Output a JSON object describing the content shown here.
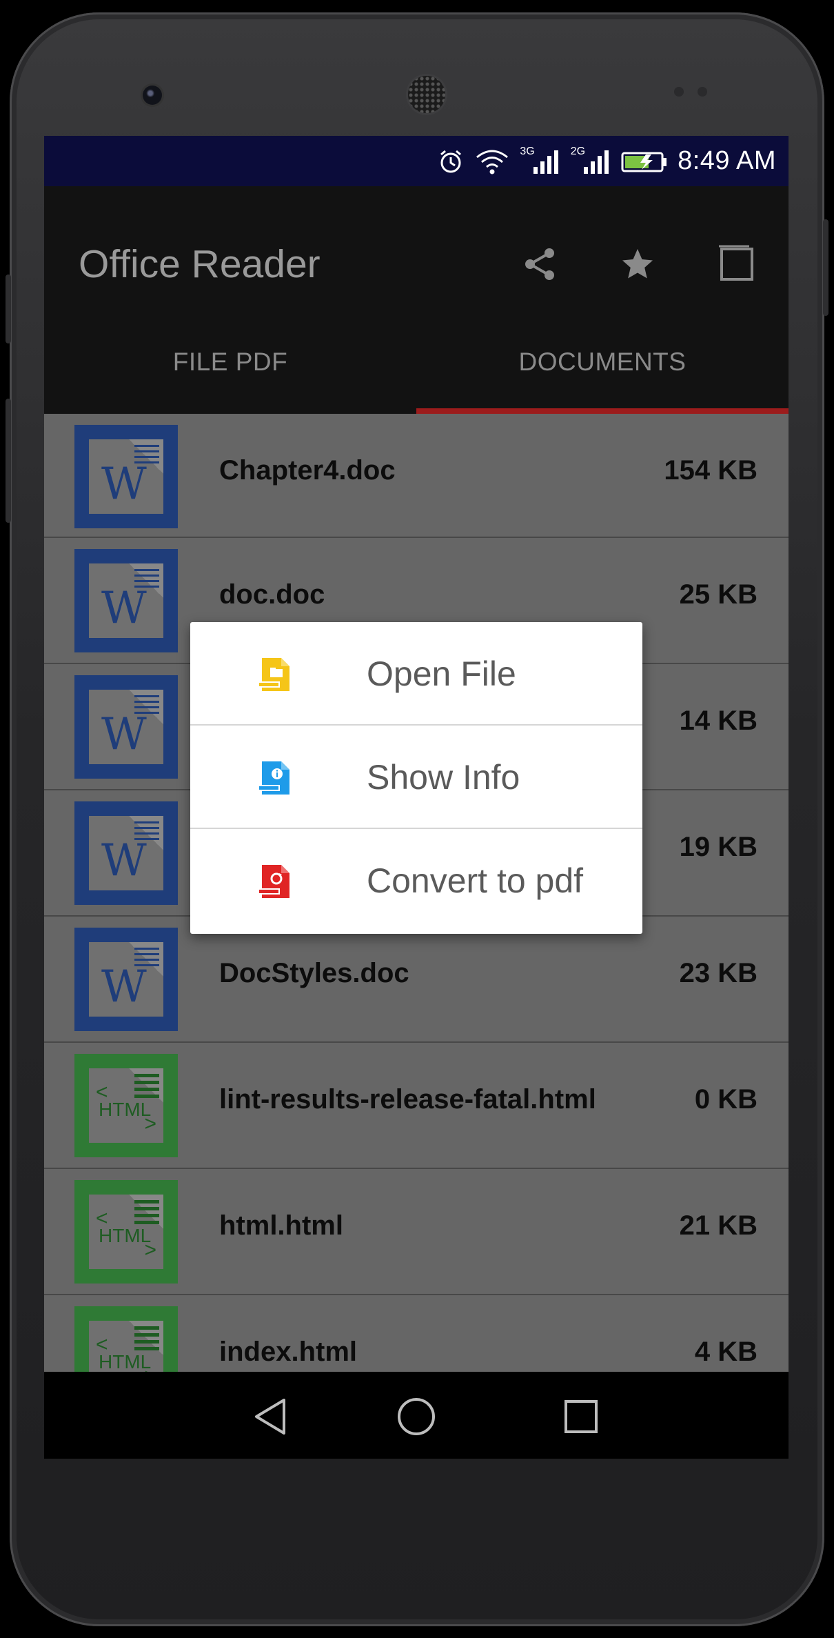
{
  "status_bar": {
    "time": "8:49 AM",
    "network_a": "3G",
    "network_b": "2G"
  },
  "app_bar": {
    "title": "Office Reader"
  },
  "tabs": [
    {
      "label": "FILE PDF"
    },
    {
      "label": "DOCUMENTS"
    }
  ],
  "files": [
    {
      "name": "Chapter4.doc",
      "size": "154 KB",
      "type": "doc"
    },
    {
      "name": "doc.doc",
      "size": "25 KB",
      "type": "doc"
    },
    {
      "name": "",
      "size": "14 KB",
      "type": "doc"
    },
    {
      "name": "",
      "size": "19 KB",
      "type": "doc"
    },
    {
      "name": "DocStyles.doc",
      "size": "23 KB",
      "type": "doc"
    },
    {
      "name": "lint-results-release-fatal.html",
      "size": "0 KB",
      "type": "html"
    },
    {
      "name": "html.html",
      "size": "21 KB",
      "type": "html"
    },
    {
      "name": "index.html",
      "size": "4 KB",
      "type": "html"
    }
  ],
  "thumb_labels": {
    "word": "W",
    "html": "HTML"
  },
  "context_menu": {
    "items": [
      {
        "label": "Open File",
        "icon": "open-file-icon",
        "color": "#f5c518"
      },
      {
        "label": "Show Info",
        "icon": "info-file-icon",
        "color": "#1e9be9"
      },
      {
        "label": "Convert to pdf",
        "icon": "convert-pdf-icon",
        "color": "#e02424"
      }
    ]
  },
  "colors": {
    "status_bar": "#0b0c3a",
    "app_bar": "#121212",
    "tab_indicator": "#9c1c1c",
    "doc_icon": "#1f3d7a",
    "html_icon": "#2f7a35"
  }
}
